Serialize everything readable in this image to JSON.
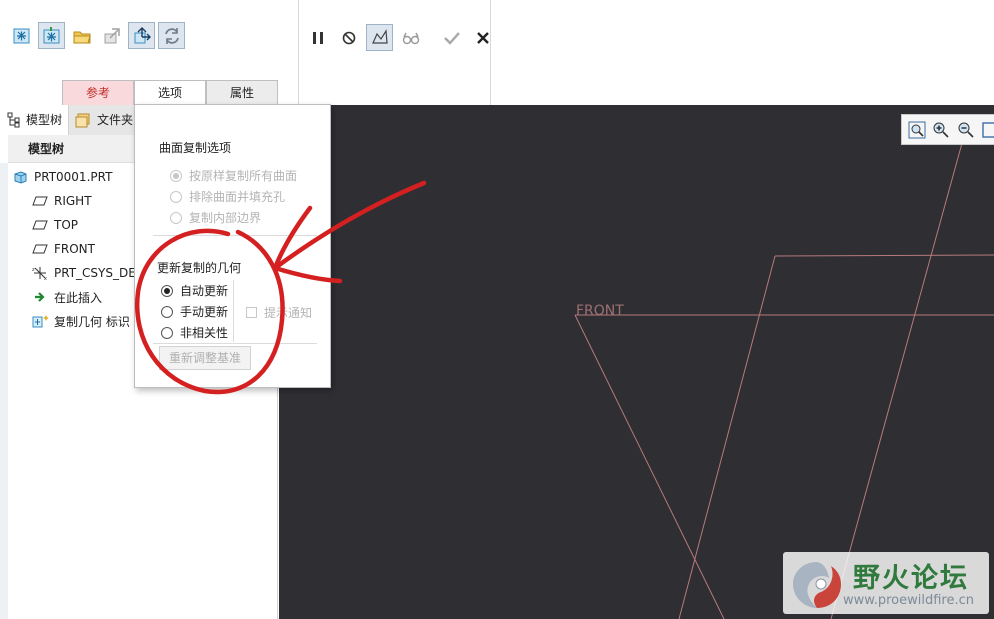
{
  "tabs": [
    {
      "label": "参考"
    },
    {
      "label": "选项"
    },
    {
      "label": "属性"
    }
  ],
  "toolbar_icons": [
    "copy-surface-icon",
    "copy-geometry-icon",
    "open-folder-icon",
    "publish-geometry-icon",
    "move-geometry-icon",
    "refresh-icon"
  ],
  "dashboard_icons": [
    "pause-icon",
    "no-preview-icon",
    "verify-icon",
    "glasses-icon",
    "ok-check-icon",
    "cancel-x-icon"
  ],
  "panel": {
    "tab_model_tree": "模型树",
    "tab_files": "文件夹"
  },
  "tree": {
    "header": "模型树",
    "items": [
      {
        "label": "PRT0001.PRT",
        "icon": "part-icon"
      },
      {
        "label": "RIGHT",
        "icon": "datum-plane-icon"
      },
      {
        "label": "TOP",
        "icon": "datum-plane-icon"
      },
      {
        "label": "FRONT",
        "icon": "datum-plane-icon"
      },
      {
        "label": "PRT_CSYS_DEF",
        "icon": "csys-icon"
      },
      {
        "label": "在此插入",
        "icon": "insert-here-arrow-icon"
      },
      {
        "label": "复制几何 标识",
        "icon": "copy-geometry-feature-icon"
      }
    ]
  },
  "popup": {
    "surface_copy_title": "曲面复制选项",
    "surface_options": [
      {
        "label": "按原样复制所有曲面",
        "checked": true
      },
      {
        "label": "排除曲面并填充孔",
        "checked": false
      },
      {
        "label": "复制内部边界",
        "checked": false
      }
    ],
    "update_title": "更新复制的几何",
    "update_options": [
      {
        "label": "自动更新",
        "checked": true
      },
      {
        "label": "手动更新",
        "checked": false
      },
      {
        "label": "非相关性",
        "checked": false
      }
    ],
    "notify_label": "提示通知",
    "rebase_button": "重新调整基准"
  },
  "graphics": {
    "datum_label": "FRONT",
    "background_color": "#2e2e33",
    "datum_line_color": "#b77a7c"
  },
  "view_icons": [
    "refit-icon",
    "zoom-in-icon",
    "zoom-out-icon",
    "repaint-icon"
  ],
  "annotation_color": "#d42020",
  "watermark": {
    "title": "野火论坛",
    "url": "www.proewildfire.cn"
  }
}
